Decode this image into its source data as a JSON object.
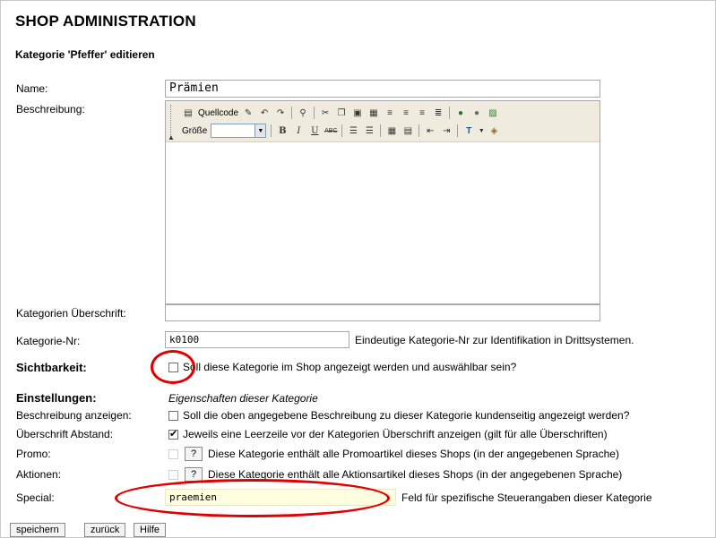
{
  "header": {
    "title": "SHOP ADMINISTRATION",
    "subtitle": "Kategorie 'Pfeffer' editieren"
  },
  "form": {
    "name_label": "Name:",
    "name_value": "Prämien",
    "description_label": "Beschreibung:",
    "editor": {
      "source_label": "Quellcode",
      "size_label": "Größe"
    },
    "heading_label": "Kategorien Überschrift:",
    "heading_value": "",
    "number_label": "Kategorie-Nr:",
    "number_value": "k0100",
    "number_hint": "Eindeutige Kategorie-Nr zur Identifikation in Drittsystemen.",
    "visibility_label": "Sichtbarkeit:",
    "visibility_text": "Soll diese Kategorie im Shop angezeigt werden und auswählbar sein?",
    "visibility_checked": false,
    "settings_label": "Einstellungen:",
    "settings_text": "Eigenschaften dieser Kategorie",
    "show_desc_label": "Beschreibung anzeigen:",
    "show_desc_text": "Soll die oben angegebene Beschreibung zu dieser Kategorie kundenseitig angezeigt werden?",
    "show_desc_checked": false,
    "heading_spacing_label": "Überschrift Abstand:",
    "heading_spacing_text": "Jeweils eine Leerzeile vor der Kategorien Überschrift anzeigen (gilt für alle Überschriften)",
    "heading_spacing_checked": true,
    "promo_label": "Promo:",
    "promo_help": "?",
    "promo_text": "Diese Kategorie enthält alle Promoartikel dieses Shops (in der angegebenen Sprache)",
    "actions_label": "Aktionen:",
    "actions_help": "?",
    "actions_text": "Diese Kategorie enthält alle Aktionsartikel dieses Shops (in der angegebenen Sprache)",
    "special_label": "Special:",
    "special_value": "praemien",
    "special_hint": "Feld für spezifische Steuerangaben dieser Kategorie"
  },
  "buttons": {
    "save": "speichern",
    "back": "zurück",
    "help": "Hilfe"
  },
  "colors": {
    "highlight_ring": "#e00000",
    "special_field": "#ffffe0",
    "toolbar": "#efebde"
  }
}
